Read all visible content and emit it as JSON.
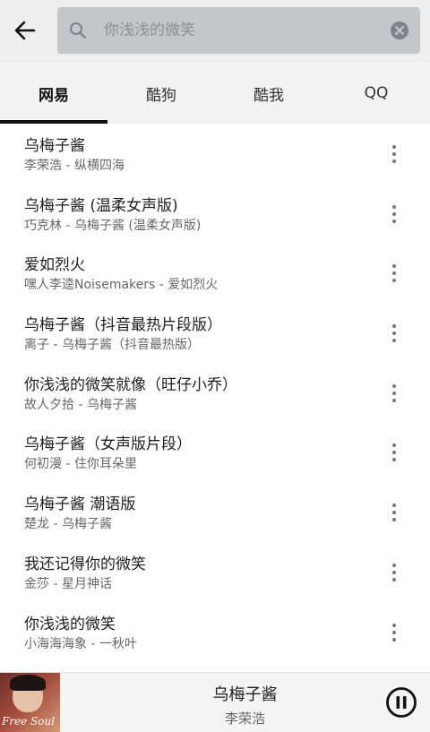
{
  "search": {
    "placeholder": "你浅浅的微笑",
    "value": ""
  },
  "tabs": [
    {
      "label": "网易",
      "active": true
    },
    {
      "label": "酷狗",
      "active": false
    },
    {
      "label": "酷我",
      "active": false
    },
    {
      "label": "QQ",
      "active": false
    }
  ],
  "songs": [
    {
      "title": "乌梅子酱",
      "subtitle": "李荣浩 - 纵横四海"
    },
    {
      "title": "乌梅子酱 (温柔女声版)",
      "subtitle": "巧克林 - 乌梅子酱 (温柔女声版)"
    },
    {
      "title": "爱如烈火",
      "subtitle": "嘿人李逵Noisemakers - 爱如烈火"
    },
    {
      "title": "乌梅子酱（抖音最热片段版）",
      "subtitle": "离子 - 乌梅子酱（抖音最热版）"
    },
    {
      "title": "你浅浅的微笑就像（旺仔小乔）",
      "subtitle": "故人夕拾 - 乌梅子酱"
    },
    {
      "title": "乌梅子酱（女声版片段）",
      "subtitle": "何初漫 - 住你耳朵里"
    },
    {
      "title": "乌梅子酱 潮语版",
      "subtitle": "楚龙 - 乌梅子酱"
    },
    {
      "title": "我还记得你的微笑",
      "subtitle": "金莎 - 星月神话"
    },
    {
      "title": "你浅浅的微笑",
      "subtitle": "小海海海象 - 一秋叶"
    }
  ],
  "player": {
    "title": "乌梅子酱",
    "artist": "李荣浩",
    "cover_text": "Free Soul",
    "state": "playing"
  },
  "icons": {
    "back": "arrow-left-icon",
    "search": "search-icon",
    "clear": "clear-icon",
    "more": "more-vertical-icon",
    "pause": "pause-icon"
  }
}
